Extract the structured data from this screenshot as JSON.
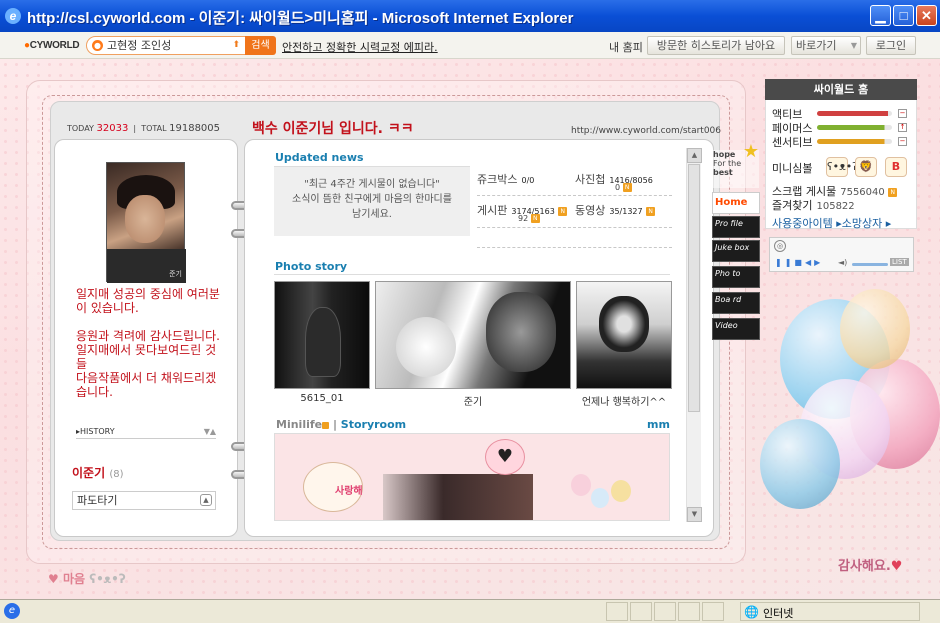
{
  "window": {
    "title": "http://csl.cyworld.com - 이준기: 싸이월드>미니홈피 - Microsoft Internet Explorer"
  },
  "toolbar": {
    "logo": "CYWORLD",
    "search_value": "고현정 조인성",
    "search_button": "검색",
    "ad_link": "안전하고 정확한 시력교정 에피라.",
    "my_home": "내 홈피",
    "history_btn": "방문한 히스토리가 남아요",
    "goto_btn": "바로가기",
    "login_btn": "로그인"
  },
  "hompy": {
    "today_label": "TODAY",
    "today_count": "32033",
    "total_label": "TOTAL",
    "total_count": "19188005",
    "title": "백수 이준기님 입니다. ㅋㅋ",
    "url": "http://www.cyworld.com/start006"
  },
  "profile": {
    "intro": "일지매 성공의 중심에 여러분이 있습니다.\n\n응원과 격려에 감사드립니다.\n일지매에서 못다보여드린 것들\n다음작품에서 더 채워드리겠습니다.",
    "history_label": "HISTORY",
    "name": "이준기",
    "name_count": "(8)",
    "select_value": "파도타기",
    "photo_caption": "준기"
  },
  "updated": {
    "heading": "Updated news",
    "empty_msg": "\"최근 4주간 게시물이 없습니다\"\n소식이 뜸한 친구에게 마음의 한마디를\n남기세요."
  },
  "stats": [
    {
      "label": "쥬크박스",
      "value": "0/0",
      "new": false
    },
    {
      "label": "사진첩",
      "value": "1416/8056",
      "value2": "0",
      "new": true
    },
    {
      "label": "게시판",
      "value": "3174/5163",
      "value2": "92",
      "new": true
    },
    {
      "label": "동영상",
      "value": "35/1327",
      "new": true
    }
  ],
  "new_badge": "N",
  "photostory": {
    "heading": "Photo story",
    "items": [
      {
        "caption": "5615_01"
      },
      {
        "caption": "준기"
      },
      {
        "caption": "언제나 행복하기^^"
      }
    ]
  },
  "minilife": {
    "label": "Minilife",
    "storyroom": "Storyroom",
    "mm": "mm",
    "room_sign": "사랑해"
  },
  "tabs": [
    {
      "label": "Home"
    },
    {
      "label": "Pro file"
    },
    {
      "label": "Juke box"
    },
    {
      "label": "Pho to"
    },
    {
      "label": "Boa rd"
    },
    {
      "label": "Video"
    }
  ],
  "hope": {
    "line1": "hope",
    "line2": "For the",
    "line3": "best"
  },
  "cyworld_home": {
    "heading": "싸이월드 홈",
    "gauges": [
      {
        "label": "액티브",
        "value": 0.95,
        "color": "#d04040"
      },
      {
        "label": "페이머스",
        "value": 0.9,
        "color": "#80b030"
      },
      {
        "label": "센서티브",
        "value": 0.9,
        "color": "#e0a020"
      }
    ],
    "mood_label": "미니심볼",
    "scrap_label": "스크랩 게시물",
    "scrap_count": "7556040",
    "fav_label": "즐겨찾기",
    "fav_count": "105822",
    "items_link": "사용중아이템 ▸소망상자 ▸",
    "player_list": "LIST"
  },
  "decor": {
    "bottom_left": "마음",
    "bottom_right": "감사해요."
  },
  "status": {
    "zone": "인터넷"
  }
}
